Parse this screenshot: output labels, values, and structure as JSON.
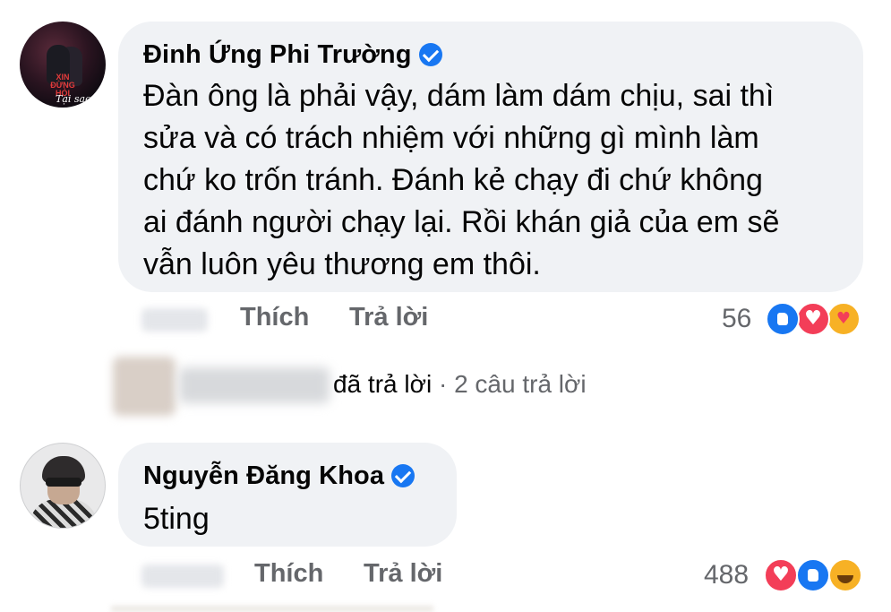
{
  "comments": [
    {
      "author": "Đinh Ứng Phi Trường",
      "verified": true,
      "avatar_text": [
        "XIN",
        "ĐỪNG",
        "HỎI"
      ],
      "avatar_script": "Tại sao",
      "body_lines": [
        "Đàn ông là phải vậy, dám làm dám chịu, sai thì",
        "sửa và có trách nhiệm với những gì mình làm",
        "chứ ko trốn tránh. Đánh kẻ chạy đi chứ không",
        "ai đánh người chạy lại. Rồi khán giả của em sẽ",
        "vẫn luôn yêu thương em thôi."
      ],
      "like_label": "Thích",
      "reply_label": "Trả lời",
      "reaction_count": "56",
      "reactions": [
        "like-icon",
        "love-icon",
        "care-icon"
      ]
    },
    {
      "author": "Nguyễn Đăng Khoa",
      "verified": true,
      "body": "5ting",
      "like_label": "Thích",
      "reply_label": "Trả lời",
      "reaction_count": "488",
      "reactions": [
        "love-icon",
        "like-icon",
        "haha-icon"
      ]
    }
  ],
  "reply_summary": {
    "action": "đã trả lời",
    "separator": "·",
    "count": "2 câu trả lời"
  },
  "colors": {
    "bubble": "#f0f2f5",
    "meta_text": "#65676b",
    "verified": "#1877f2",
    "love": "#f33e58",
    "care": "#f7b125"
  }
}
